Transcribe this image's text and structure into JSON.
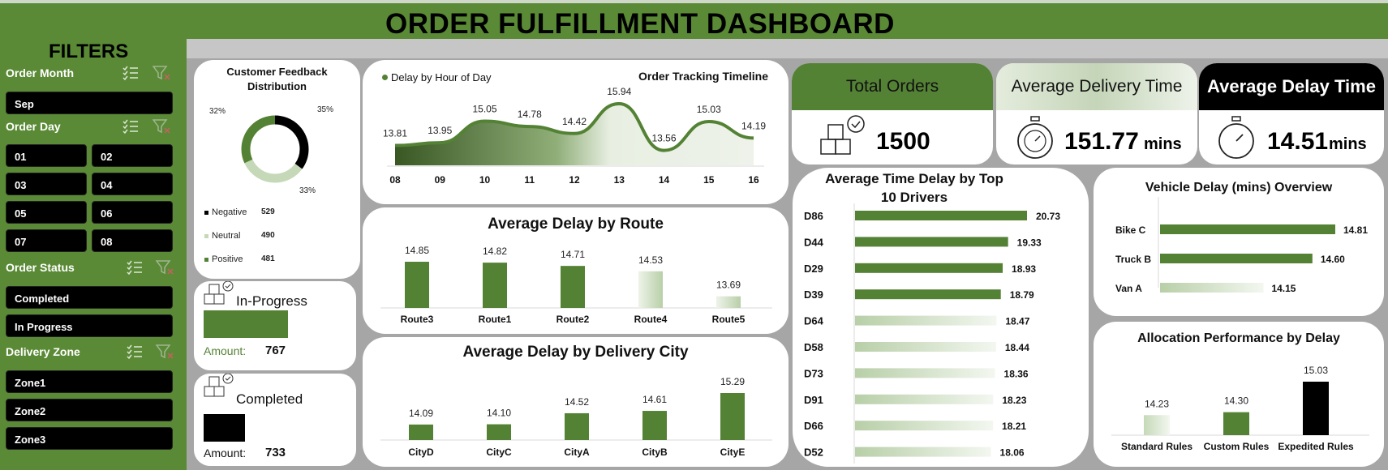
{
  "header": {
    "title": "ORDER FULFILLMENT DASHBOARD"
  },
  "filters": {
    "title": "FILTERS",
    "order_month": {
      "label": "Order Month",
      "options": [
        "Sep"
      ]
    },
    "order_day": {
      "label": "Order Day",
      "options": [
        "01",
        "02",
        "03",
        "04",
        "05",
        "06",
        "07",
        "08"
      ]
    },
    "order_status": {
      "label": "Order Status",
      "options": [
        "Completed",
        "In Progress"
      ]
    },
    "delivery_zone": {
      "label": "Delivery Zone",
      "options": [
        "Zone1",
        "Zone2",
        "Zone3"
      ]
    }
  },
  "feedback": {
    "title_line1": "Customer Feedback",
    "title_line2": "Distribution",
    "pct_negative": "35%",
    "pct_neutral": "33%",
    "pct_positive": "32%",
    "legend": [
      {
        "label": "Negative",
        "value": "529"
      },
      {
        "label": "Neutral",
        "value": "490"
      },
      {
        "label": "Positive",
        "value": "481"
      }
    ]
  },
  "in_progress": {
    "label": "In-Progress",
    "amount_label": "Amount:",
    "amount": "767"
  },
  "completed": {
    "label": "Completed",
    "amount_label": "Amount:",
    "amount": "733"
  },
  "kpis": {
    "total_orders": {
      "label": "Total Orders",
      "value": "1500"
    },
    "avg_delivery": {
      "label": "Average Delivery Time",
      "value": "151.77",
      "unit": "mins"
    },
    "avg_delay": {
      "label": "Average Delay Time",
      "value": "14.51",
      "unit": "mins"
    }
  },
  "colors": {
    "green": "#548235",
    "black": "#000000",
    "light_green": "#c5d9b8",
    "grey": "#a6a6a6"
  },
  "chart_data": [
    {
      "type": "area",
      "title": "Order Tracking Timeline",
      "series": [
        {
          "name": "Delay by Hour of Day",
          "values": [
            13.81,
            13.95,
            15.05,
            14.78,
            14.42,
            15.94,
            13.56,
            15.03,
            14.19
          ]
        }
      ],
      "x": [
        "08",
        "09",
        "10",
        "11",
        "12",
        "13",
        "14",
        "15",
        "16"
      ]
    },
    {
      "type": "bar",
      "title": "Average Delay by Route",
      "categories": [
        "Route3",
        "Route1",
        "Route2",
        "Route4",
        "Route5"
      ],
      "values": [
        14.85,
        14.82,
        14.71,
        14.53,
        13.69
      ],
      "labels": [
        "14.85",
        "14.82",
        "14.71",
        "14.53",
        "13.69"
      ]
    },
    {
      "type": "bar",
      "title": "Average Delay by Delivery City",
      "categories": [
        "CityD",
        "CityC",
        "CityA",
        "CityB",
        "CityE"
      ],
      "values": [
        14.09,
        14.1,
        14.52,
        14.61,
        15.29
      ],
      "labels": [
        "14.09",
        "14.10",
        "14.52",
        "14.61",
        "15.29"
      ]
    },
    {
      "type": "bar",
      "orientation": "horizontal",
      "title": "Average Time Delay by Top 10 Drivers",
      "title_line1": "Average Time Delay by Top",
      "title_line2": "10 Drivers",
      "categories": [
        "D86",
        "D44",
        "D29",
        "D39",
        "D64",
        "D58",
        "D73",
        "D91",
        "D66",
        "D52"
      ],
      "values": [
        20.73,
        19.33,
        18.93,
        18.79,
        18.47,
        18.44,
        18.36,
        18.23,
        18.21,
        18.06
      ],
      "labels": [
        "20.73",
        "19.33",
        "18.93",
        "18.79",
        "18.47",
        "18.44",
        "18.36",
        "18.23",
        "18.21",
        "18.06"
      ]
    },
    {
      "type": "bar",
      "orientation": "horizontal",
      "title": "Vehicle Delay (mins) Overview",
      "categories": [
        "Bike C",
        "Truck B",
        "Van A"
      ],
      "values": [
        14.81,
        14.6,
        14.15
      ],
      "labels": [
        "14.81",
        "14.60",
        "14.15"
      ]
    },
    {
      "type": "bar",
      "title": "Allocation Performance by Delay",
      "categories": [
        "Standard Rules",
        "Custom Rules",
        "Expedited Rules"
      ],
      "values": [
        14.23,
        14.3,
        15.03
      ],
      "labels": [
        "14.23",
        "14.30",
        "15.03"
      ]
    }
  ]
}
